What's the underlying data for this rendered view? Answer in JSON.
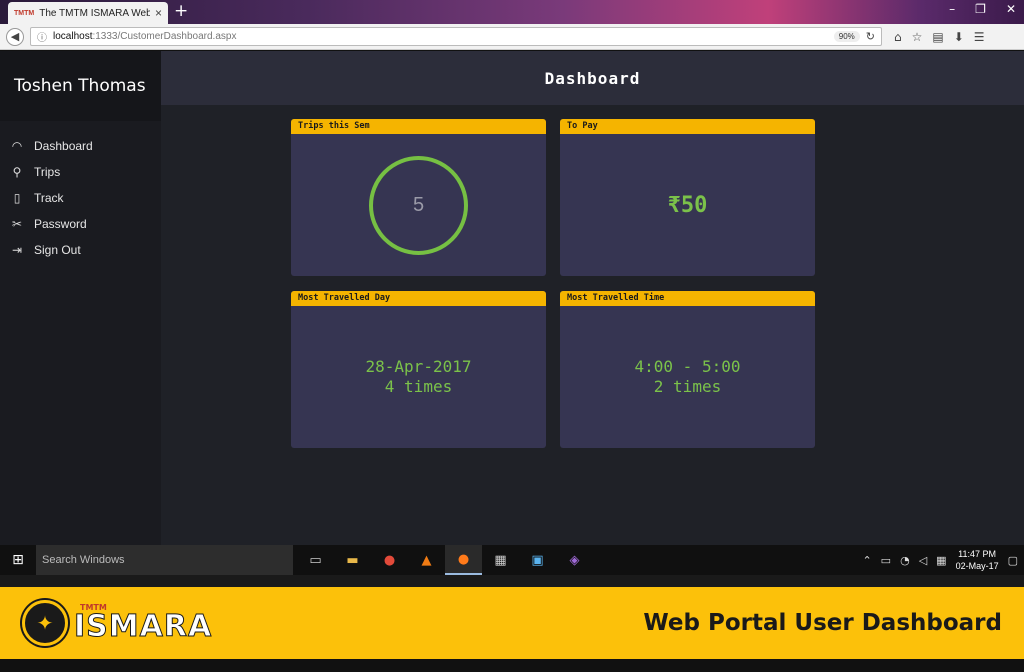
{
  "browser": {
    "tab_favicon": "TMTM",
    "tab_title": "The TMTM ISMARA Website",
    "tab_close": "×",
    "new_tab": "+",
    "url_host": "localhost",
    "url_path": ":1333/CustomerDashboard.aspx",
    "zoom": "90%",
    "window_controls": [
      "–",
      "❐",
      "✕"
    ]
  },
  "app": {
    "user_name": "Toshen Thomas",
    "page_title": "Dashboard",
    "menu": [
      {
        "label": "Dashboard",
        "icon": "gauge-icon",
        "glyph": "◠"
      },
      {
        "label": "Trips",
        "icon": "map-pin-icon",
        "glyph": "⚲"
      },
      {
        "label": "Track",
        "icon": "mobile-icon",
        "glyph": "▯"
      },
      {
        "label": "Password",
        "icon": "tools-icon",
        "glyph": "✂"
      },
      {
        "label": "Sign Out",
        "icon": "sign-out-icon",
        "glyph": "⇥"
      }
    ],
    "cards": {
      "trips": {
        "title": "Trips this Sem",
        "value": "5"
      },
      "to_pay": {
        "title": "To Pay",
        "value": "₹50"
      },
      "day": {
        "title": "Most Travelled Day",
        "line1": "28-Apr-2017",
        "line2": "4 times"
      },
      "time": {
        "title": "Most Travelled Time",
        "line1": "4:00 - 5:00",
        "line2": "2 times"
      }
    },
    "colors": {
      "accent": "#f5b400",
      "value_green": "#7bc24a",
      "card_bg": "#363552"
    }
  },
  "taskbar": {
    "search_placeholder": "Search Windows",
    "time": "11:47 PM",
    "date": "02-May-17"
  },
  "banner": {
    "logo_small": "TMTM",
    "logo_word": "ISMARA",
    "caption": "Web Portal User Dashboard"
  }
}
